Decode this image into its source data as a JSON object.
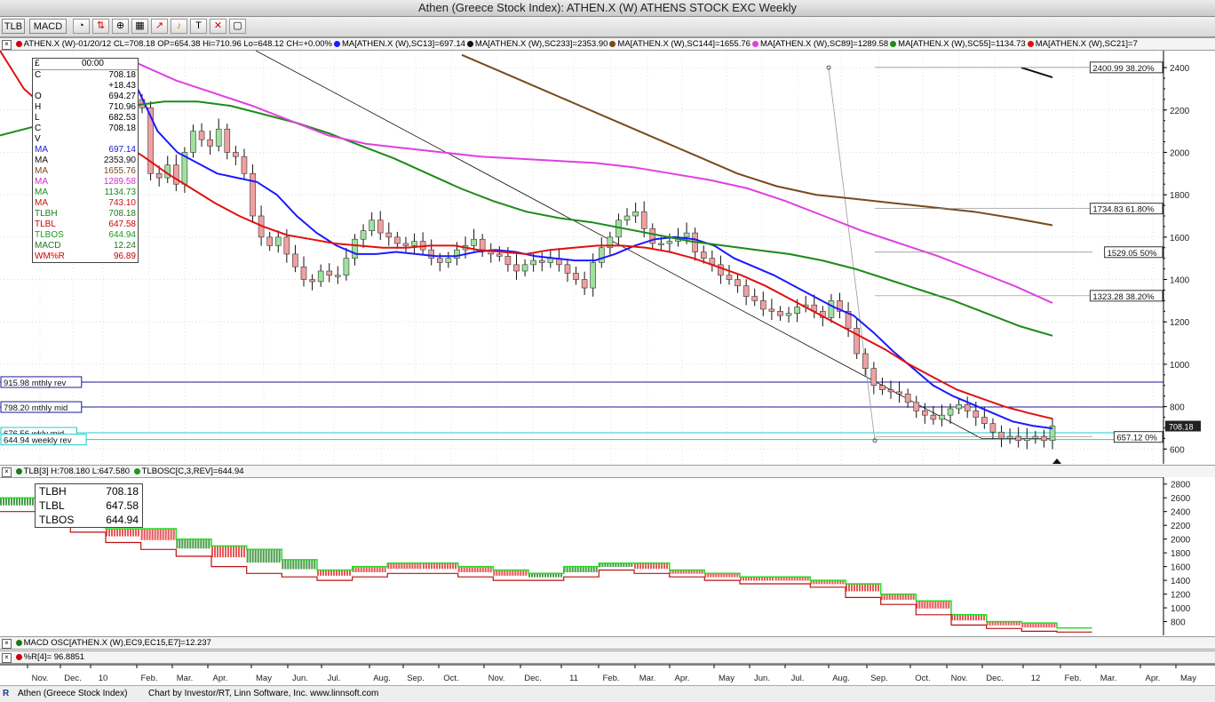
{
  "window": {
    "title": "Athen (Greece Stock Index): ATHEN.X (W) ATHENS STOCK EXC Weekly"
  },
  "toolbar": {
    "tlb_label": "TLB",
    "macd_label": "MACD"
  },
  "main_legend": [
    {
      "text": "ATHEN.X (W)-01/20/12 CL=708.18 OP=654.38 Hi=710.96 Lo=648.12 CH=+0.00%",
      "color": "#000000",
      "dot": "#cc0000"
    },
    {
      "text": "MA[ATHEN.X (W),SC13]=697.14",
      "color": "#000000",
      "dot": "#1a1aff"
    },
    {
      "text": "MA[ATHEN.X (W),SC233]=2353.90",
      "color": "#000000",
      "dot": "#111111"
    },
    {
      "text": "MA[ATHEN.X (W),SC144]=1655.76",
      "color": "#000000",
      "dot": "#7a4a1a"
    },
    {
      "text": "MA[ATHEN.X (W),SC89]=1289.58",
      "color": "#000000",
      "dot": "#e040e0"
    },
    {
      "text": "MA[ATHEN.X (W),SC55]=1134.73",
      "color": "#000000",
      "dot": "#1a8a1a"
    },
    {
      "text": "MA[ATHEN.X (W),SC21]=7",
      "color": "#000000",
      "dot": "#e01010"
    }
  ],
  "databox": {
    "header_symbol": "£",
    "header_time": "00:00",
    "rows": [
      {
        "label": "C",
        "value": "708.18",
        "color": "#000000"
      },
      {
        "label": "",
        "value": "+18.43",
        "color": "#000000"
      },
      {
        "label": "O",
        "value": "694.27",
        "color": "#000000"
      },
      {
        "label": "H",
        "value": "710.96",
        "color": "#000000"
      },
      {
        "label": "L",
        "value": "682.53",
        "color": "#000000"
      },
      {
        "label": "C",
        "value": "708.18",
        "color": "#000000"
      },
      {
        "label": "V",
        "value": "",
        "color": "#000000"
      },
      {
        "label": "MA",
        "value": "697.14",
        "color": "#1a1acc"
      },
      {
        "label": "MA",
        "value": "2353.90",
        "color": "#111111"
      },
      {
        "label": "MA",
        "value": "1655.76",
        "color": "#7a4a1a"
      },
      {
        "label": "MA",
        "value": "1289.58",
        "color": "#d030d0"
      },
      {
        "label": "MA",
        "value": "1134.73",
        "color": "#1a8a1a"
      },
      {
        "label": "MA",
        "value": "743.10",
        "color": "#d01010"
      },
      {
        "label": "TLBH",
        "value": "708.18",
        "color": "#1a7a1a"
      },
      {
        "label": "TLBL",
        "value": "647.58",
        "color": "#cc0000"
      },
      {
        "label": "TLBOS",
        "value": "644.94",
        "color": "#1a9a1a"
      },
      {
        "label": "MACD",
        "value": "12.24",
        "color": "#1a7a1a"
      },
      {
        "label": "WM%R",
        "value": "96.89",
        "color": "#cc0000"
      }
    ]
  },
  "price_annotations": {
    "fib": [
      {
        "label": "2400.99 38.20%",
        "value": 2400.99
      },
      {
        "label": "1734.83 61.80%",
        "value": 1734.83
      },
      {
        "label": "1529.05 50%",
        "value": 1529.05
      },
      {
        "label": "1323.28 38.20%",
        "value": 1323.28
      },
      {
        "label": "657.12 0%",
        "value": 657.12
      }
    ],
    "levels": [
      {
        "label": "915.98 mthly rev",
        "value": 915.98,
        "color": "#1a1a9a"
      },
      {
        "label": "798.20 mthly mid",
        "value": 798.2,
        "color": "#1a1a9a"
      },
      {
        "label": "676.56 wkly mid",
        "value": 676.56,
        "color": "#22cccc"
      },
      {
        "label": "644.94 weekly rev",
        "value": 644.94,
        "color": "#22cccc"
      }
    ],
    "last_price_tag": "708.18"
  },
  "tlb_legend": {
    "parts": [
      {
        "text": "TLB[3] H:708.180 L:647.580",
        "dot": "#1a7a1a"
      },
      {
        "text": "TLBOSC[C,3,REV]=644.94",
        "dot": "#1a9a1a"
      }
    ]
  },
  "tlb_box": {
    "rows": [
      {
        "label": "TLBH",
        "value": "708.18"
      },
      {
        "label": "TLBL",
        "value": "647.58"
      },
      {
        "label": "TLBOS",
        "value": "644.94"
      }
    ]
  },
  "macd_legend": {
    "text": "MACD OSC[ATHEN.X (W),EC9,EC15,E7]=12.237",
    "dot": "#1a7a1a"
  },
  "wr_legend": {
    "text": "%R[4]= 96.8851",
    "dot": "#cc0000"
  },
  "footer": {
    "symbol_text": "Athen (Greece Stock Index)",
    "credit": "Chart by Investor/RT, Linn Software, Inc. www.linnsoft.com"
  },
  "chart_data": [
    {
      "type": "candlestick",
      "title": "Athen (Greece Stock Index): ATHEN.X (W) ATHENS STOCK EXC Weekly",
      "ylim": [
        530,
        2480
      ],
      "y_ticks": [
        600,
        800,
        1000,
        1200,
        1400,
        1600,
        1800,
        2000,
        2200,
        2400
      ],
      "x_tick_labels": [
        "Nov.",
        "Dec.",
        "10",
        "Feb.",
        "Mar.",
        "Apr.",
        "May",
        "Jun.",
        "Jul.",
        "Aug.",
        "Sep.",
        "Oct.",
        "Nov.",
        "Dec.",
        "11",
        "Feb.",
        "Mar.",
        "Apr.",
        "May",
        "Jun.",
        "Jul.",
        "Aug.",
        "Sep.",
        "Oct.",
        "Nov.",
        "Dec.",
        "12",
        "Feb.",
        "Mar.",
        "Apr.",
        "May"
      ],
      "closes": [
        2210,
        1900,
        1880,
        1940,
        1850,
        2000,
        2100,
        2060,
        2030,
        2110,
        2000,
        1980,
        1900,
        1700,
        1600,
        1560,
        1600,
        1520,
        1460,
        1400,
        1390,
        1440,
        1420,
        1420,
        1500,
        1590,
        1630,
        1680,
        1620,
        1600,
        1570,
        1560,
        1580,
        1540,
        1500,
        1480,
        1500,
        1540,
        1560,
        1590,
        1540,
        1520,
        1510,
        1470,
        1440,
        1470,
        1490,
        1480,
        1500,
        1470,
        1430,
        1400,
        1360,
        1480,
        1550,
        1600,
        1680,
        1700,
        1720,
        1640,
        1570,
        1570,
        1580,
        1600,
        1620,
        1530,
        1500,
        1470,
        1420,
        1400,
        1370,
        1320,
        1300,
        1260,
        1250,
        1230,
        1240,
        1270,
        1280,
        1250,
        1220,
        1300,
        1250,
        1170,
        1050,
        980,
        900,
        880,
        870,
        860,
        820,
        780,
        760,
        740,
        760,
        790,
        810,
        780,
        750,
        720,
        680,
        650,
        660,
        640,
        650,
        660,
        640,
        708.18
      ],
      "series": [
        {
          "name": "MA SC13",
          "color": "#1a1aff",
          "values": [
            2300,
            2100,
            2000,
            1950,
            1900,
            1880,
            1860,
            1800,
            1700,
            1620,
            1560,
            1520,
            1520,
            1530,
            1520,
            1510,
            1510,
            1530,
            1540,
            1530,
            1510,
            1500,
            1490,
            1490,
            1520,
            1560,
            1590,
            1600,
            1590,
            1560,
            1500,
            1460,
            1420,
            1370,
            1320,
            1270,
            1230,
            1150,
            1060,
            980,
            900,
            850,
            810,
            770,
            730,
            710,
            697.14
          ]
        },
        {
          "name": "MA SC21",
          "color": "#e01010",
          "values": [
            2480,
            2300,
            2200,
            2150,
            2100,
            2050,
            1980,
            1900,
            1830,
            1760,
            1700,
            1650,
            1610,
            1590,
            1570,
            1560,
            1550,
            1550,
            1560,
            1560,
            1540,
            1530,
            1520,
            1540,
            1550,
            1560,
            1560,
            1550,
            1530,
            1500,
            1460,
            1420,
            1370,
            1310,
            1250,
            1190,
            1130,
            1070,
            1000,
            940,
            880,
            840,
            800,
            770,
            743.1
          ]
        },
        {
          "name": "MA SC55",
          "color": "#1a8a1a",
          "values": [
            2080,
            2120,
            2160,
            2190,
            2220,
            2240,
            2240,
            2220,
            2180,
            2140,
            2090,
            2030,
            1970,
            1900,
            1830,
            1770,
            1720,
            1690,
            1670,
            1640,
            1610,
            1580,
            1560,
            1540,
            1520,
            1490,
            1450,
            1400,
            1350,
            1300,
            1240,
            1180,
            1134.73
          ]
        },
        {
          "name": "MA SC89",
          "color": "#e040e0",
          "values": [
            2420,
            2340,
            2280,
            2220,
            2150,
            2080,
            2040,
            2020,
            2000,
            1980,
            1970,
            1960,
            1950,
            1930,
            1900,
            1870,
            1830,
            1770,
            1700,
            1630,
            1570,
            1510,
            1440,
            1370,
            1289.58
          ]
        },
        {
          "name": "MA SC144",
          "color": "#7a4a1a",
          "values": [
            2460,
            2380,
            2300,
            2220,
            2140,
            2060,
            1980,
            1900,
            1840,
            1800,
            1780,
            1760,
            1740,
            1720,
            1690,
            1655.76
          ]
        },
        {
          "name": "MA SC233",
          "color": "#111111",
          "values": [
            2400,
            2353.9
          ]
        }
      ]
    },
    {
      "type": "bar",
      "name": "TLB[3]",
      "ylim": [
        600,
        2900
      ],
      "y_ticks": [
        800,
        1000,
        1200,
        1400,
        1600,
        1800,
        2000,
        2200,
        2400,
        2600,
        2800
      ],
      "series": [
        {
          "name": "TLBH",
          "values": [
            2600,
            2450,
            2450,
            2150,
            2150,
            2000,
            1900,
            1850,
            1700,
            1550,
            1600,
            1650,
            1650,
            1600,
            1550,
            1500,
            1600,
            1650,
            1650,
            1550,
            1500,
            1450,
            1450,
            1400,
            1350,
            1200,
            1100,
            900,
            800,
            780,
            708.18
          ]
        },
        {
          "name": "TLBL",
          "values": [
            2400,
            2250,
            2100,
            1950,
            1850,
            1750,
            1600,
            1500,
            1450,
            1400,
            1450,
            1500,
            1500,
            1450,
            1400,
            1400,
            1450,
            1550,
            1500,
            1450,
            1400,
            1350,
            1350,
            1300,
            1150,
            1050,
            900,
            750,
            700,
            660,
            647.58
          ]
        }
      ]
    }
  ]
}
